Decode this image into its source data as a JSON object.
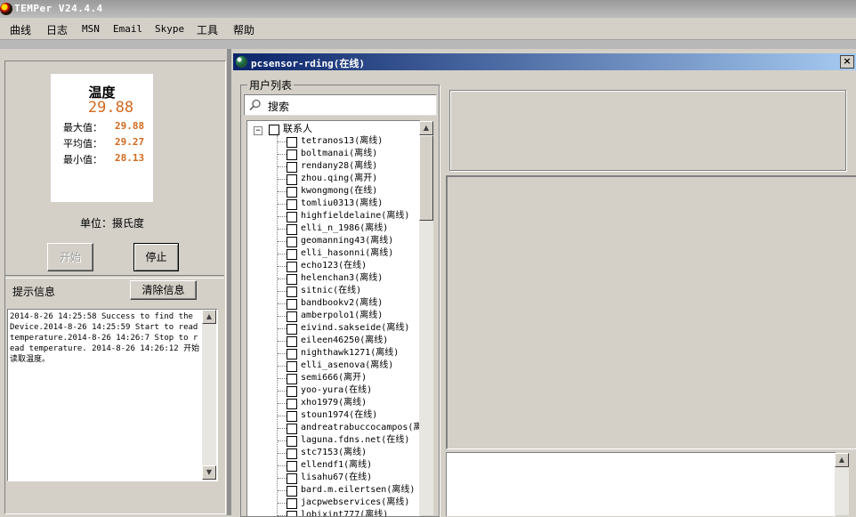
{
  "app": {
    "title": "TEMPer V24.4.4"
  },
  "menu": [
    "曲线",
    "日志",
    "MSN",
    "Email",
    "Skype",
    "工具",
    "帮助"
  ],
  "temperature": {
    "title": "温度",
    "current": "29.88",
    "max_label": "最大值：",
    "max_value": "29.88",
    "avg_label": "平均值：",
    "avg_value": "29.27",
    "min_label": "最小值：",
    "min_value": "28.13",
    "unit": "单位：摄氏度"
  },
  "controls": {
    "start_label": "开始",
    "stop_label": "停止"
  },
  "info": {
    "label": "提示信息",
    "clear_label": "清除信息",
    "log": "2014-8-26 14:25:58 Success to find the Device.2014-8-26 14:25:59 Start to read temperature.2014-8-26 14:26:7 Stop to read temperature. 2014-8-26 14:26:12 开始读取温度。"
  },
  "chat": {
    "title": "pcsensor-rding(在线)",
    "user_list_label": "用户列表",
    "search_placeholder": "搜索",
    "root_label": "联系人",
    "contacts": [
      "tetranos13(离线)",
      "boltmanai(离线)",
      "rendany28(离线)",
      "zhou.qing(离开)",
      "kwongmong(在线)",
      "tomliu0313(离线)",
      "highfieldelaine(离线)",
      "elli_n_1986(离线)",
      "geomanning43(离线)",
      "elli_hasonni(离线)",
      "echo123(在线)",
      "helenchan3(离线)",
      "sitnic(在线)",
      "bandbookv2(离线)",
      "amberpolo1(离线)",
      "eivind.sakseide(离线)",
      "eileen46250(离线)",
      "nighthawk1271(离线)",
      "elli_asenova(离线)",
      "semi666(离开)",
      "yoo-yura(在线)",
      "xho1979(离线)",
      "stoun1974(在线)",
      "andreatrabuccocampos(离",
      "laguna.fdns.net(在线)",
      "stc7153(离线)",
      "ellendf1(离线)",
      "lisahu67(在线)",
      "bard.m.eilertsen(离线)",
      "jacpwebservices(离线)",
      "lobixint777(离线)"
    ]
  },
  "colors": {
    "accent": "#d2691e",
    "title_bar": "#0a246a"
  }
}
